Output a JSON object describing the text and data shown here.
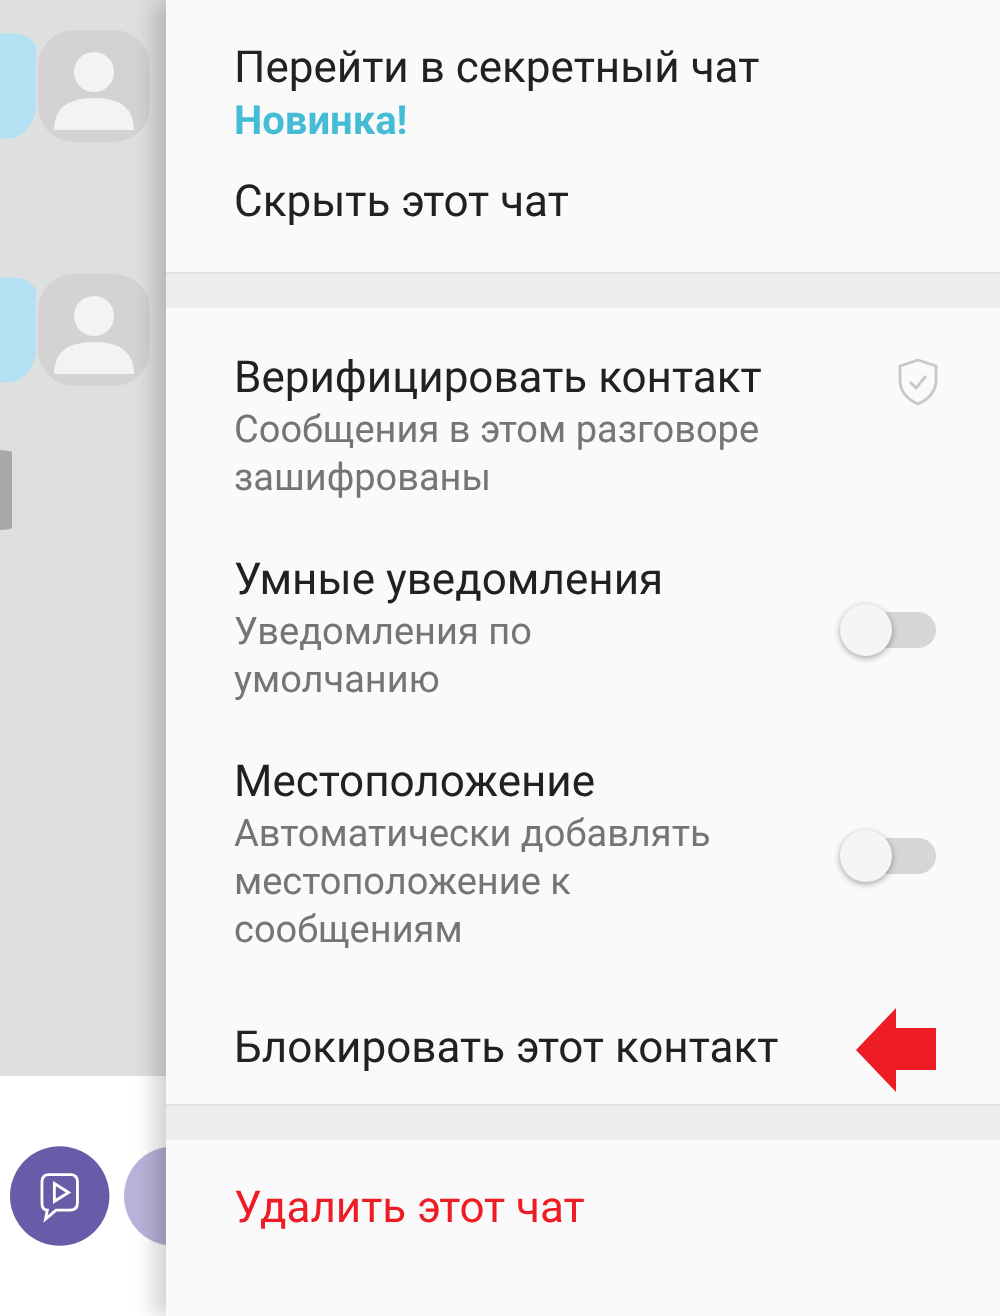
{
  "menu": {
    "sections": [
      {
        "items": [
          {
            "kind": "action",
            "title": "Перейти в секретный чат",
            "badge": "Новинка!"
          },
          {
            "kind": "action",
            "title": "Скрыть этот чат"
          }
        ]
      },
      {
        "items": [
          {
            "kind": "verify",
            "title": "Верифицировать контакт",
            "subtitle": "Сообщения в этом разговоре зашифрованы"
          },
          {
            "kind": "toggle",
            "title": "Умные уведомления",
            "subtitle": "Уведомления по умолчанию",
            "on": false
          },
          {
            "kind": "toggle",
            "title": "Местоположение",
            "subtitle": "Автоматически добавлять местоположение к сообщениям",
            "on": false
          },
          {
            "kind": "action",
            "title": "Блокировать этот контакт",
            "pointed": true
          }
        ]
      },
      {
        "items": [
          {
            "kind": "danger",
            "title": "Удалить этот чат"
          }
        ]
      }
    ]
  }
}
